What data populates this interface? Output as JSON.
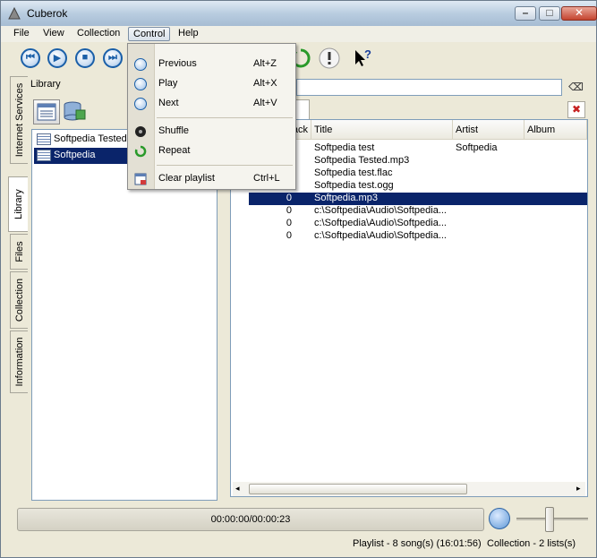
{
  "window": {
    "title": "Cuberok"
  },
  "menubar": {
    "items": [
      "File",
      "View",
      "Collection",
      "Control",
      "Help"
    ],
    "active": "Control"
  },
  "control_menu": {
    "items": [
      {
        "label": "Previous",
        "accel": "Alt+Z",
        "icon": "previous-icon"
      },
      {
        "label": "Play",
        "accel": "Alt+X",
        "icon": "play-icon"
      },
      {
        "label": "Next",
        "accel": "Alt+V",
        "icon": "next-icon"
      },
      {
        "label": "Shuffle",
        "accel": "",
        "icon": "shuffle-icon"
      },
      {
        "label": "Repeat",
        "accel": "",
        "icon": "repeat-icon"
      },
      {
        "label": "Clear playlist",
        "accel": "Ctrl+L",
        "icon": "clear-playlist-icon"
      }
    ]
  },
  "side_tabs": [
    "Internet Services",
    "Library",
    "Files",
    "Collection",
    "Information"
  ],
  "library": {
    "header": "Library",
    "items": [
      {
        "label": "Softpedia Tested",
        "selected": false
      },
      {
        "label": "Softpedia",
        "selected": true
      }
    ]
  },
  "tracks": {
    "columns": [
      "Track",
      "Title",
      "Artist",
      "Album"
    ],
    "rows": [
      {
        "track": "",
        "title": "Softpedia test",
        "artist": "Softpedia",
        "album": ""
      },
      {
        "track": "",
        "title": "Softpedia Tested.mp3",
        "artist": "",
        "album": ""
      },
      {
        "track": "",
        "title": "Softpedia test.flac",
        "artist": "",
        "album": ""
      },
      {
        "track": "",
        "title": "Softpedia test.ogg",
        "artist": "",
        "album": ""
      },
      {
        "track": "0",
        "title": "Softpedia.mp3",
        "artist": "",
        "album": "",
        "selected": true
      },
      {
        "track": "0",
        "title": "c:\\Softpedia\\Audio\\Softpedia...",
        "artist": "",
        "album": ""
      },
      {
        "track": "0",
        "title": "c:\\Softpedia\\Audio\\Softpedia...",
        "artist": "",
        "album": ""
      },
      {
        "track": "0",
        "title": "c:\\Softpedia\\Audio\\Softpedia...",
        "artist": "",
        "album": ""
      }
    ]
  },
  "player": {
    "time": "00:00:00/00:00:23"
  },
  "status": {
    "playlist": "Playlist - 8 song(s) (16:01:56)",
    "collection": "Collection - 2 lists(s)"
  },
  "colors": {
    "selection": "#0a246a",
    "accent": "#1a5fa8"
  }
}
